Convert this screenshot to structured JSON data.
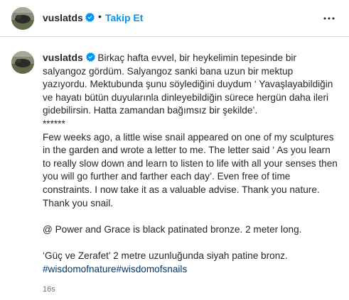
{
  "header": {
    "username": "vuslatds",
    "separator": "•",
    "follow_label": "Takip Et",
    "more_icon": "more-horizontal-icon"
  },
  "caption": {
    "username": "vuslatds",
    "text_tr": "Birkaç hafta evvel, bir heykelimin tepesinde bir salyangoz gördüm. Salyangoz sanki bana uzun bir mektup yazıyordu. Mektubunda şunu söylediğini duydum ‘ Yavaşlayabildiğin ve hayatı bütün duyularınla dinleyebildiğin sürece hergün daha ileri gidebilirsin. Hatta zamandan bağımsız bir şekilde’.",
    "stars": "******",
    "text_en": "Few weeks ago, a little wise snail appeared on one of my sculptures in the garden and wrote a letter to me. The letter said ‘ As you learn to really slow down and learn to listen to life with all your senses then you will go further and farther each day’. Even free of time constraints. I now take it as a valuable advise. Thank you nature. Thank you snail.",
    "info_en": "@ Power and Grace is black patinated bronze. 2 meter long.",
    "info_tr": "‘Güç ve Zerafet’ 2 metre uzunluğunda siyah patine bronz.",
    "hashtags": "#wisdomofnature#wisdomofsnails"
  },
  "timestamp": "16s",
  "colors": {
    "accent": "#0095f6",
    "verified": "#0095f6",
    "hashtag": "#00376b",
    "text": "#262626",
    "muted": "#737373"
  }
}
